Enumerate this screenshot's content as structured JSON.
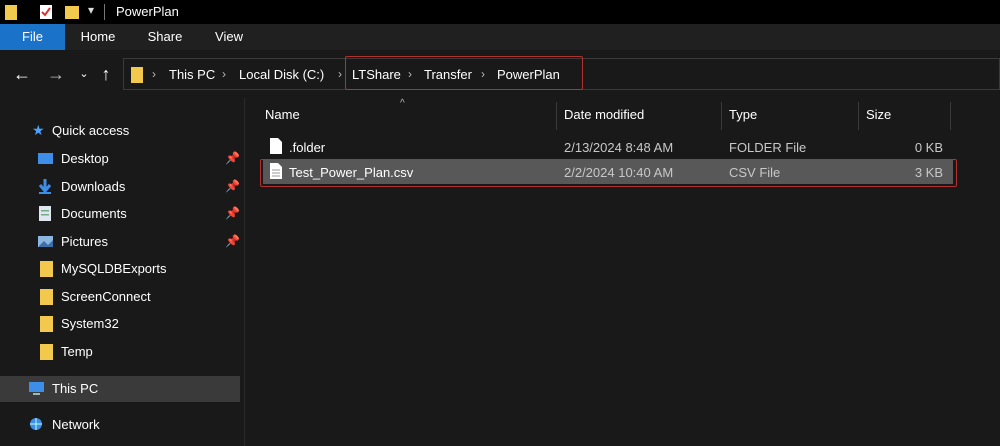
{
  "window": {
    "title": "PowerPlan"
  },
  "ribbon": {
    "tabs": [
      "File",
      "Home",
      "Share",
      "View"
    ]
  },
  "address": {
    "crumbs": [
      "This PC",
      "Local Disk (C:)",
      "LTShare",
      "Transfer",
      "PowerPlan"
    ]
  },
  "sidebar": {
    "quick_access": "Quick access",
    "items": [
      {
        "label": "Desktop",
        "icon": "desktop-icon",
        "pinned": true
      },
      {
        "label": "Downloads",
        "icon": "downloads-icon",
        "pinned": true
      },
      {
        "label": "Documents",
        "icon": "documents-icon",
        "pinned": true
      },
      {
        "label": "Pictures",
        "icon": "pictures-icon",
        "pinned": true
      },
      {
        "label": "MySQLDBExports",
        "icon": "folder-icon",
        "pinned": false
      },
      {
        "label": "ScreenConnect",
        "icon": "folder-icon",
        "pinned": false
      },
      {
        "label": "System32",
        "icon": "folder-icon",
        "pinned": false
      },
      {
        "label": "Temp",
        "icon": "folder-icon",
        "pinned": false
      }
    ],
    "this_pc": "This PC",
    "network": "Network"
  },
  "columns": {
    "name": "Name",
    "date": "Date modified",
    "type": "Type",
    "size": "Size"
  },
  "files": [
    {
      "name": ".folder",
      "date": "2/13/2024 8:48 AM",
      "type": "FOLDER File",
      "size": "0 KB"
    },
    {
      "name": "Test_Power_Plan.csv",
      "date": "2/2/2024 10:40 AM",
      "type": "CSV File",
      "size": "3 KB"
    }
  ],
  "colors": {
    "accent": "#1a73c8",
    "highlight_border": "#b0312f",
    "folder": "#f2c94c"
  }
}
